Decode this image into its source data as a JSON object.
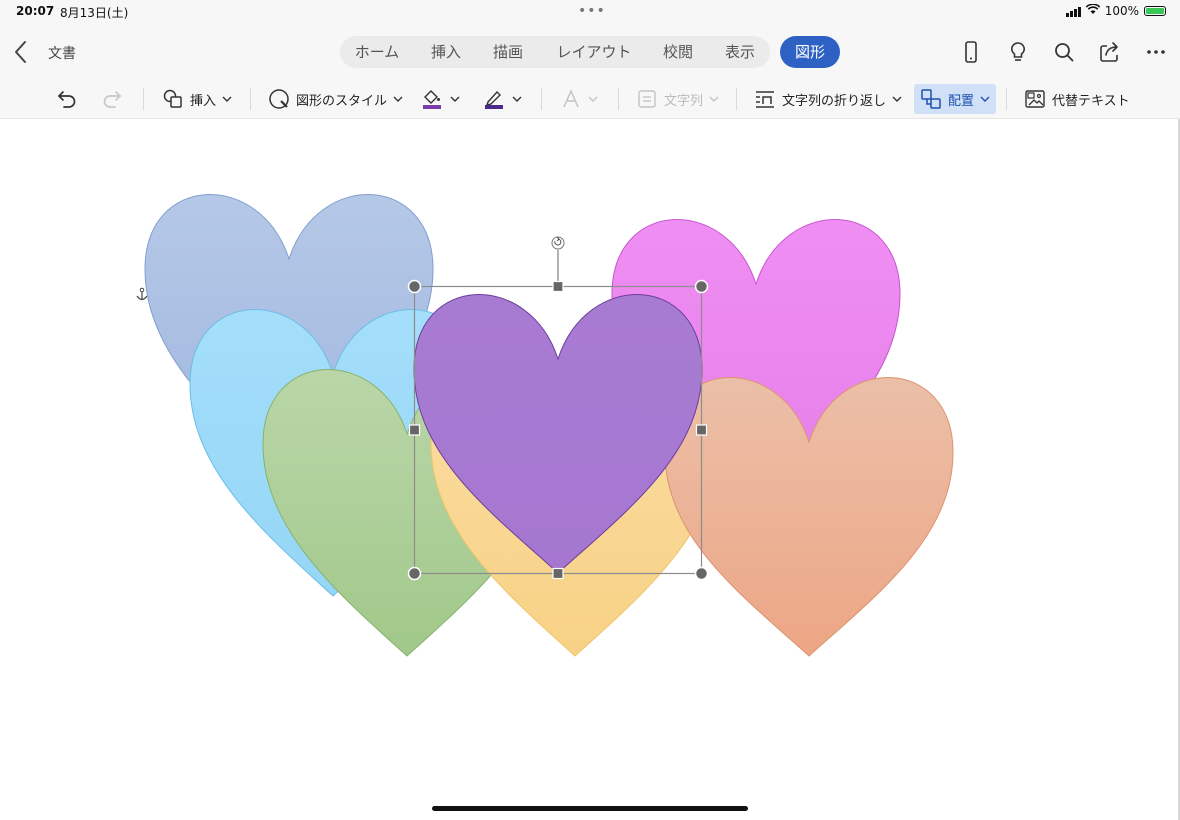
{
  "status": {
    "time": "20:07",
    "date": "8月13日(土)",
    "battery_text": "100%",
    "battery_level": 1.0
  },
  "header": {
    "doc_title": "文書",
    "tabs": [
      "ホーム",
      "挿入",
      "描画",
      "レイアウト",
      "校閲",
      "表示"
    ],
    "active_tab": "図形"
  },
  "ribbon": {
    "insert_label": "挿入",
    "shape_style_label": "図形のスタイル",
    "text_direction_label": "文字列",
    "text_wrap_label": "文字列の折り返し",
    "arrange_label": "配置",
    "alt_text_label": "代替テキスト"
  },
  "icons": {
    "back": "chevron-left-icon",
    "phone_view": "phone-icon",
    "ideas": "lightbulb-icon",
    "search": "search-icon",
    "share": "share-icon",
    "more": "more-icon",
    "undo": "undo-icon",
    "redo": "redo-icon",
    "insert_shape": "shapes-icon",
    "shape_style": "shape-style-icon",
    "fill": "fill-bucket-icon",
    "outline": "pen-outline-icon",
    "text_effects": "text-effects-icon",
    "text_box": "text-direction-icon",
    "wrap": "wrap-text-icon",
    "arrange": "arrange-icon",
    "alt_text": "alt-text-icon",
    "anchor": "anchor-icon",
    "rotate": "rotate-handle-icon"
  },
  "colors": {
    "accent": "#2e61c4",
    "fill_icon_color": "#7a3ea8",
    "outline_icon_color": "#4b2a8a",
    "hearts": [
      {
        "name": "blue",
        "fill_top": "#b5c8e7",
        "fill_bottom": "#9fb6de",
        "stroke": "#7f9fd0"
      },
      {
        "name": "light-blue",
        "fill_top": "#a4defa",
        "fill_bottom": "#95d6f6",
        "stroke": "#6bbde8"
      },
      {
        "name": "green",
        "fill_top": "#bad6a8",
        "fill_bottom": "#a1c88a",
        "stroke": "#86b36c"
      },
      {
        "name": "yellow",
        "fill_top": "#fbdca2",
        "fill_bottom": "#f7d285",
        "stroke": "#eec668"
      },
      {
        "name": "magenta",
        "fill_top": "#ef8ef3",
        "fill_bottom": "#e67ee9",
        "stroke": "#c855cf"
      },
      {
        "name": "orange",
        "fill_top": "#ebbfa8",
        "fill_bottom": "#eda685",
        "stroke": "#dc9370"
      },
      {
        "name": "purple",
        "fill_top": "#a87bd3",
        "fill_bottom": "#a577d0",
        "stroke": "#6c3c9c"
      }
    ]
  }
}
